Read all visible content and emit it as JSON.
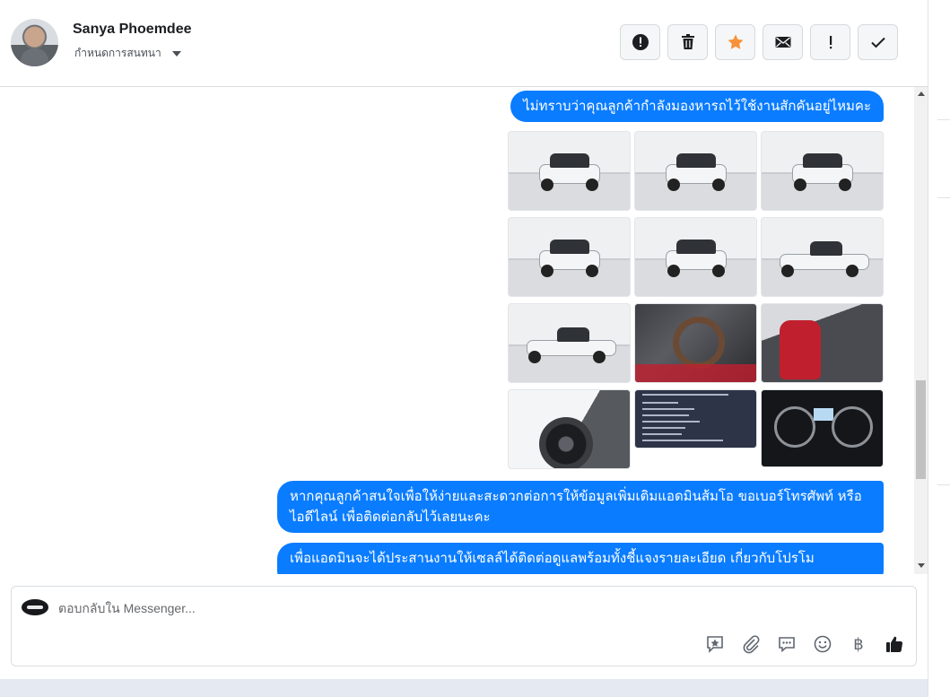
{
  "header": {
    "contact_name": "Sanya Phoemdee",
    "conversation_label": "กำหนดการสนทนา",
    "toolbar": [
      {
        "icon": "alert-circle-icon"
      },
      {
        "icon": "trash-icon"
      },
      {
        "icon": "star-icon",
        "color": "#f7923a"
      },
      {
        "icon": "envelope-icon"
      },
      {
        "icon": "exclamation-icon"
      },
      {
        "icon": "check-icon"
      }
    ]
  },
  "messages": [
    {
      "text": "ไม่ทราบว่าคุณลูกค้ากำลังมองหารถไว้ใช้งานสักคันอยู่ไหมคะ"
    },
    {
      "text": "หากคุณลูกค้าสนใจเพื่อให้ง่ายและสะดวกต่อการให้ข้อมูลเพิ่มเติมแอดมินส้มโอ ขอเบอร์โทรศัพท์ หรือ ไอดีไลน์ เพื่อติดต่อกลับไว้เลยนะคะ"
    },
    {
      "text": "เพื่อแอดมินจะได้ประสานงานให้เซลล์ได้ติดต่อดูแลพร้อมทั้งชี้แจงรายละเอียด เกี่ยวกับโปรโม"
    }
  ],
  "composer": {
    "placeholder": "ตอบกลับใน Messenger...",
    "tools": [
      {
        "icon": "saved-reply-icon"
      },
      {
        "icon": "paperclip-icon"
      },
      {
        "icon": "chat-bubble-icon"
      },
      {
        "icon": "emoji-icon"
      },
      {
        "icon": "baht-icon",
        "glyph": "฿"
      },
      {
        "icon": "thumbs-up-icon"
      }
    ]
  },
  "colors": {
    "bubble": "#0a7cff",
    "star": "#f7923a"
  }
}
